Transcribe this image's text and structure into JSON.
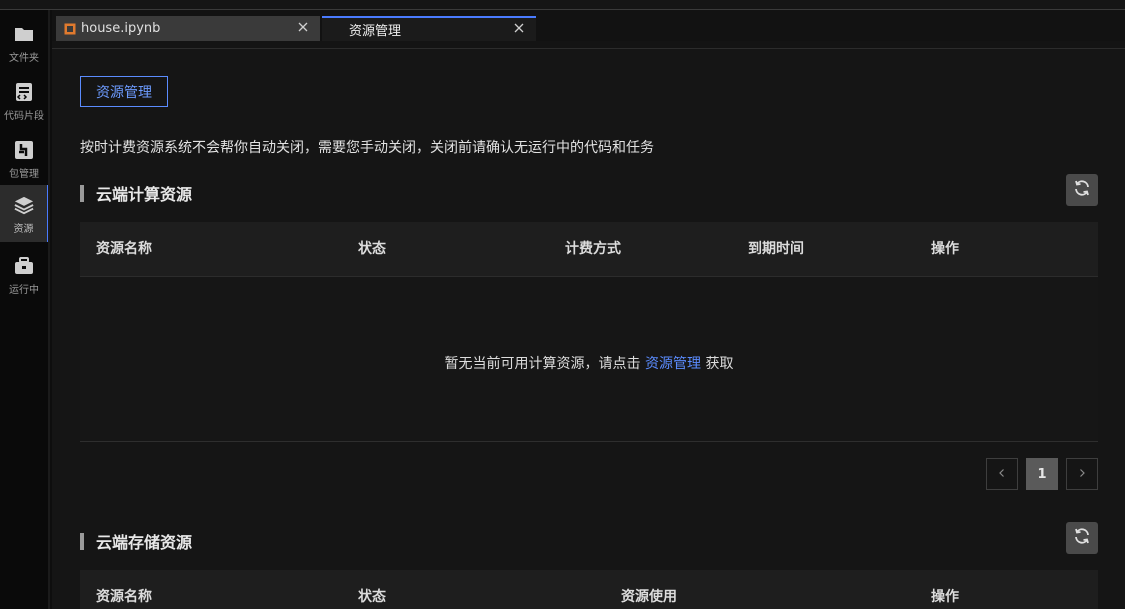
{
  "sidebar": {
    "items": [
      {
        "label": "文件夹",
        "icon": "folder-icon"
      },
      {
        "label": "代码片段",
        "icon": "code-snippet-icon"
      },
      {
        "label": "包管理",
        "icon": "package-icon"
      },
      {
        "label": "资源",
        "icon": "layers-icon",
        "active": true
      },
      {
        "label": "运行中",
        "icon": "briefcase-icon"
      }
    ]
  },
  "tabs": [
    {
      "title": "house.ipynb",
      "icon": "notebook-icon",
      "active": false
    },
    {
      "title": "资源管理",
      "active": true
    }
  ],
  "main": {
    "resource_button": "资源管理",
    "notice": "按时计费资源系统不会帮你自动关闭，需要您手动关闭，关闭前请确认无运行中的代码和任务",
    "compute": {
      "title": "云端计算资源",
      "columns": [
        "资源名称",
        "状态",
        "计费方式",
        "到期时间",
        "操作"
      ],
      "empty_prefix": "暂无当前可用计算资源，请点击 ",
      "empty_link": "资源管理",
      "empty_suffix": " 获取"
    },
    "pagination": {
      "prev": "<",
      "current": "1",
      "next": ">"
    },
    "storage": {
      "title": "云端存储资源",
      "columns": [
        "资源名称",
        "状态",
        "资源使用",
        "操作"
      ]
    }
  },
  "colors": {
    "accent": "#4a7bff",
    "link": "#5b8cff",
    "background": "#151515"
  }
}
